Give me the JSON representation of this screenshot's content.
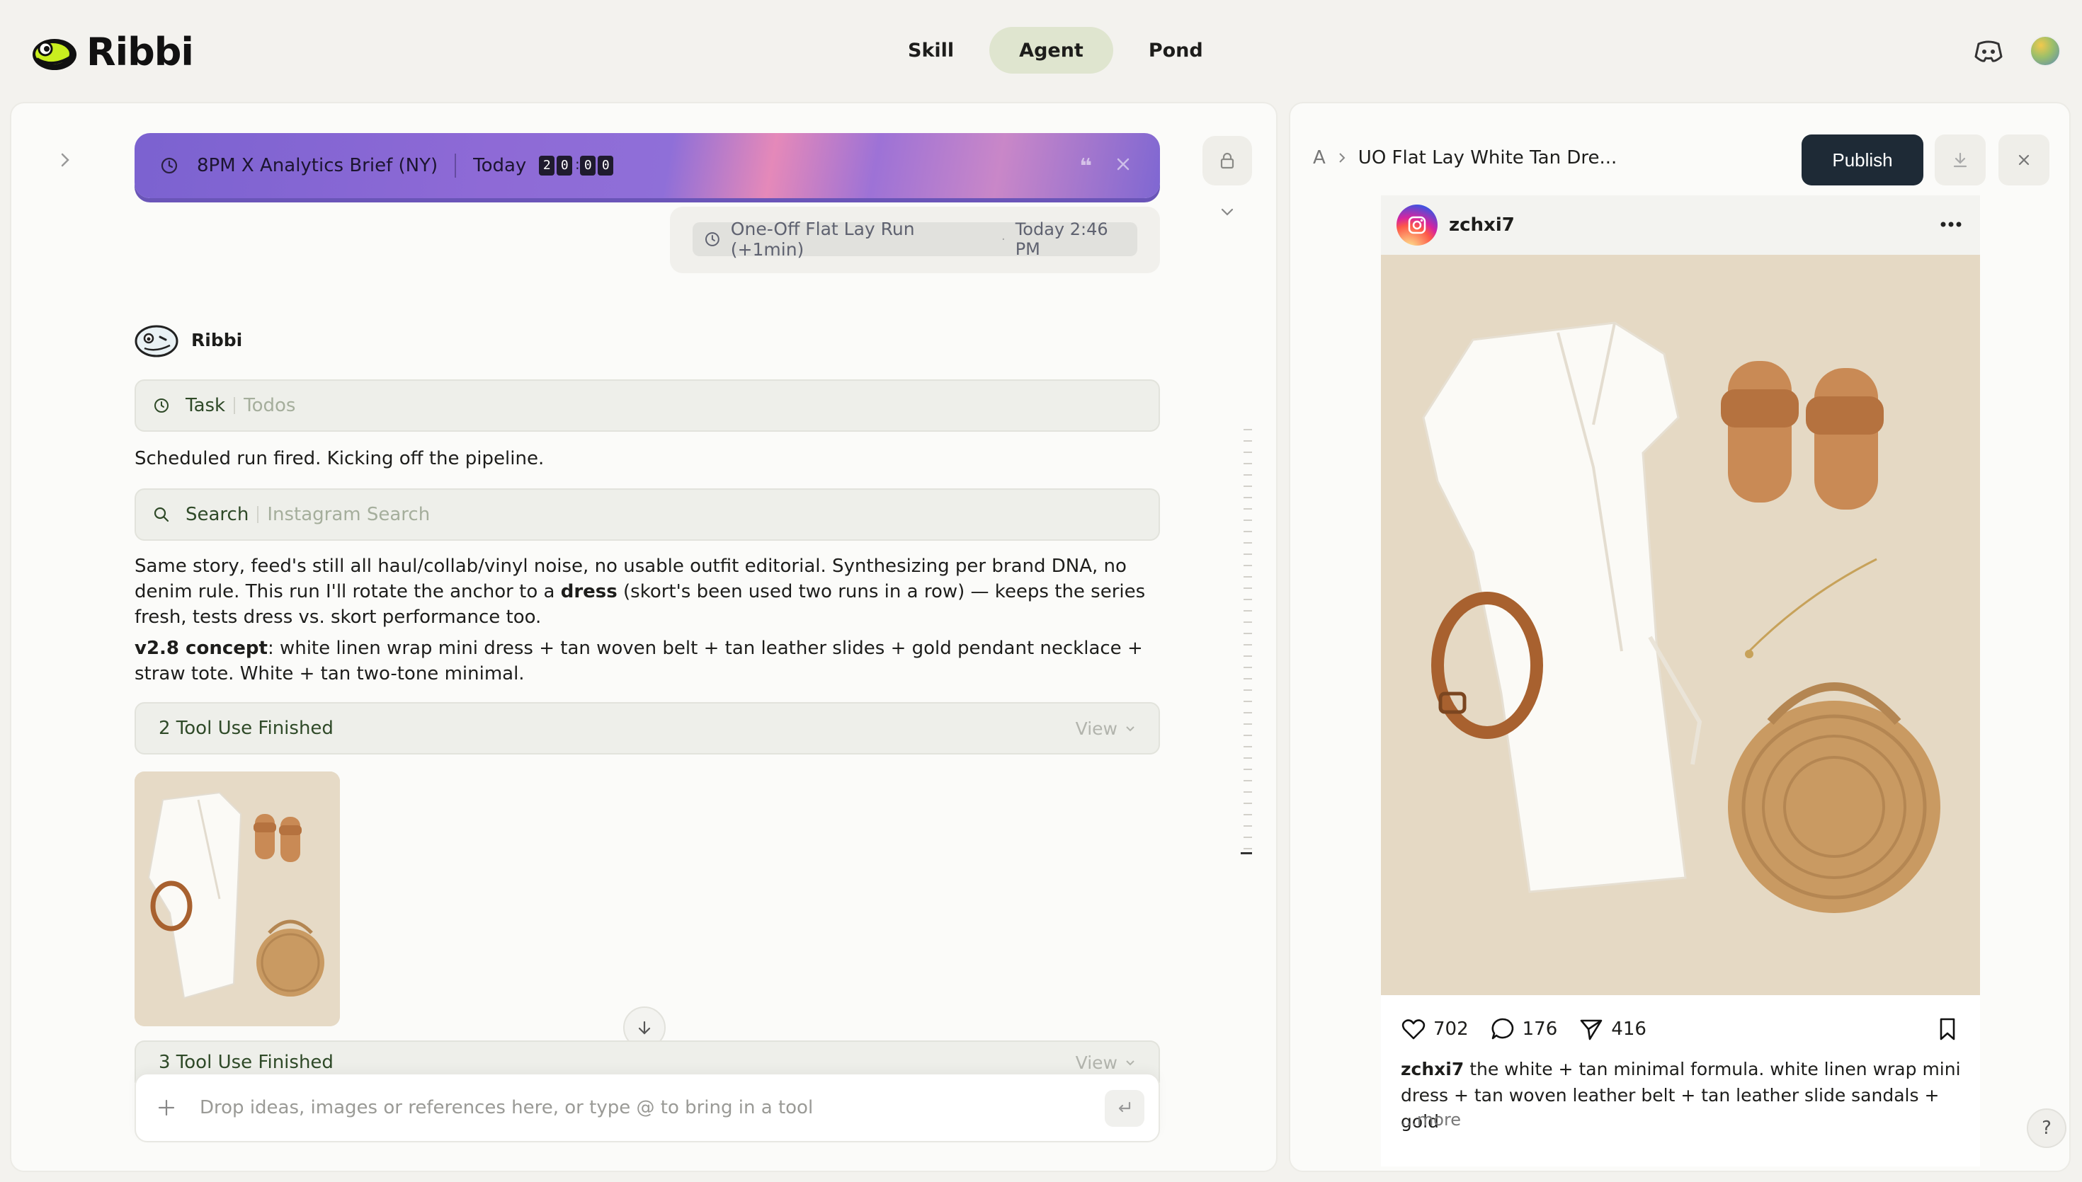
{
  "app": {
    "name": "Ribbi"
  },
  "nav": {
    "tabs": [
      {
        "label": "Skill"
      },
      {
        "label": "Agent"
      },
      {
        "label": "Pond"
      }
    ],
    "active": "Agent"
  },
  "schedule": {
    "title": "8PM X Analytics Brief (NY)",
    "day": "Today",
    "digits": [
      "2",
      "0",
      "0",
      "0"
    ],
    "quote_glyph": "❝"
  },
  "oneoff": {
    "title": "One-Off Flat Lay Run (+1min)",
    "time": "Today 2:46 PM"
  },
  "agent": {
    "name": "Ribbi"
  },
  "task_tool": {
    "label": "Task",
    "sub": "Todos"
  },
  "messages": {
    "m1": "Scheduled run fired. Kicking off the pipeline.",
    "m2_part1": "Same story, feed's still all haul/collab/vinyl noise, no usable outfit editorial. Synthesizing per brand DNA, no denim rule. This run I'll rotate the anchor to a ",
    "m2_bold": "dress",
    "m2_part2": " (skort's been used two runs in a row) — keeps the series fresh, tests dress vs. skort performance too.",
    "m3_bold": "v2.8 concept",
    "m3_rest": ": white linen wrap mini dress + tan woven belt + tan leather slides + gold pendant necklace + straw tote. White + tan two-tone minimal."
  },
  "search_tool": {
    "label": "Search",
    "sub": "Instagram Search"
  },
  "finished": [
    {
      "label": "2 Tool Use Finished",
      "view": "View"
    },
    {
      "label": "3 Tool Use Finished",
      "view": "View"
    }
  ],
  "composer": {
    "placeholder": "Drop ideas, images or references here, or type @ to bring in a tool"
  },
  "preview": {
    "crumb_root": "A",
    "crumb_title": "UO Flat Lay White Tan Dre...",
    "publish_label": "Publish",
    "post": {
      "username": "zchxi7",
      "likes": "702",
      "comments": "176",
      "shares": "416",
      "caption_user": "zchxi7",
      "caption_text": " the white + tan minimal formula. white linen wrap mini dress + tan woven leather belt + tan leather slide sandals + gold",
      "more": "...more"
    },
    "help": "?"
  },
  "colors": {
    "accent_tab": "#dfe5cf",
    "publish_bg": "#1e2a36",
    "banner_purple": "#8e6ad6",
    "banner_pink": "#e589b9",
    "tool_green": "#2f4a28"
  }
}
